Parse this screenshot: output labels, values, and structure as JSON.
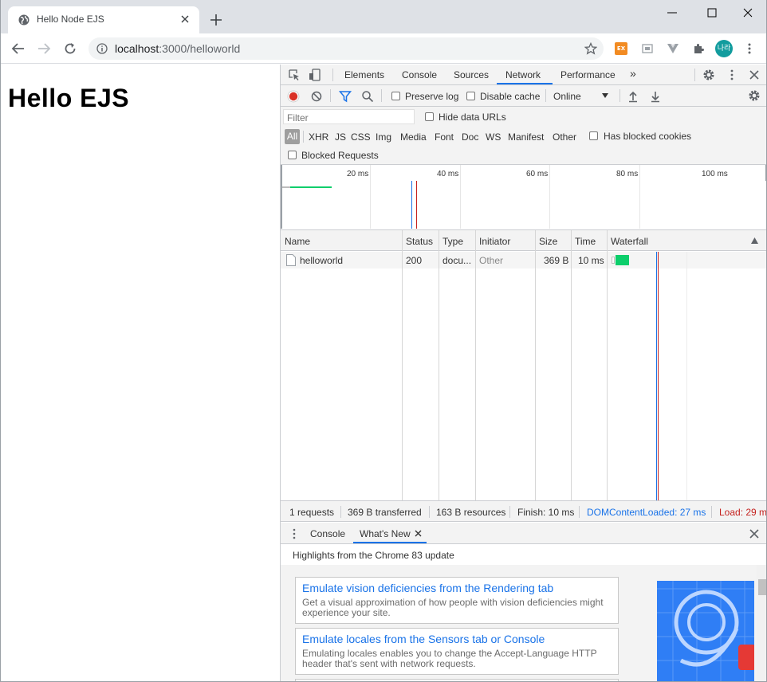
{
  "browser": {
    "tab_title": "Hello Node EJS",
    "url_host": "localhost",
    "url_rest": ":3000/helloworld",
    "profile_initials": "나라",
    "extension_label": "EX"
  },
  "page": {
    "heading": "Hello EJS"
  },
  "devtools": {
    "tabs": [
      "Elements",
      "Console",
      "Sources",
      "Network",
      "Performance"
    ],
    "active_tab": "Network",
    "more_tabs": "»",
    "network_toolbar": {
      "preserve_log": "Preserve log",
      "disable_cache": "Disable cache",
      "throttle": "Online"
    },
    "filter": {
      "placeholder": "Filter",
      "hide_data_urls": "Hide data URLs",
      "types": [
        "All",
        "XHR",
        "JS",
        "CSS",
        "Img",
        "Media",
        "Font",
        "Doc",
        "WS",
        "Manifest",
        "Other"
      ],
      "has_blocked_cookies": "Has blocked cookies",
      "blocked_requests": "Blocked Requests"
    },
    "overview_ticks": [
      "20 ms",
      "40 ms",
      "60 ms",
      "80 ms",
      "100 ms"
    ],
    "columns": [
      "Name",
      "Status",
      "Type",
      "Initiator",
      "Size",
      "Time",
      "Waterfall"
    ],
    "requests": [
      {
        "name": "helloworld",
        "status": "200",
        "type": "docu...",
        "initiator": "Other",
        "size": "369 B",
        "time": "10 ms"
      }
    ],
    "summary": {
      "requests": "1 requests",
      "transferred": "369 B transferred",
      "resources": "163 B resources",
      "finish": "Finish: 10 ms",
      "dom_content_loaded": "DOMContentLoaded: 27 ms",
      "load": "Load: 29 m"
    },
    "drawer": {
      "tabs": [
        "Console",
        "What's New"
      ],
      "active_tab": "What's New",
      "highlights": "Highlights from the Chrome 83 update",
      "cards": [
        {
          "title": "Emulate vision deficiencies from the Rendering tab",
          "desc": "Get a visual approximation of how people with vision deficiencies might experience your site."
        },
        {
          "title": "Emulate locales from the Sensors tab or Console",
          "desc": "Emulating locales enables you to change the Accept-Language HTTP header that's sent with network requests."
        }
      ]
    }
  },
  "colors": {
    "accent": "#1a73e8",
    "record": "#e53935",
    "waterfall_bar": "#0cce6b",
    "dcl": "#1a73e8",
    "load": "#c5221f"
  }
}
